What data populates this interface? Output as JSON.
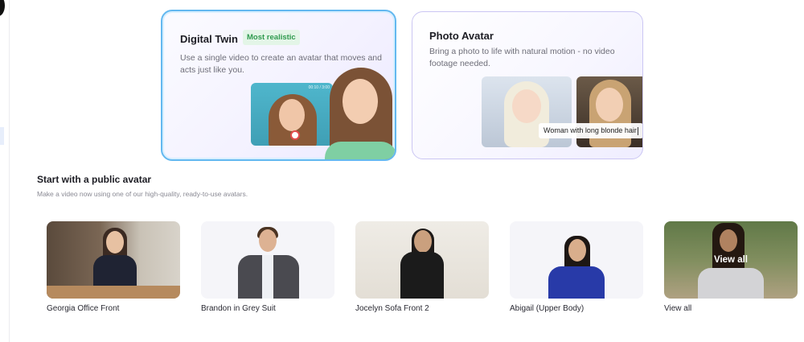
{
  "cards": {
    "digital_twin": {
      "title": "Digital Twin",
      "badge": "Most realistic",
      "description": "Use a single video to create an avatar that moves and acts just like you.",
      "video_timer": "00:10 / 3:00"
    },
    "photo_avatar": {
      "title": "Photo Avatar",
      "description": "Bring a photo to life with natural motion - no video footage needed.",
      "prompt_caption": "Woman with long blonde hair"
    }
  },
  "public_avatars": {
    "title": "Start with a public avatar",
    "subtitle": "Make a video now using one of our high-quality, ready-to-use avatars.",
    "items": [
      {
        "label": "Georgia Office Front"
      },
      {
        "label": "Brandon in Grey Suit"
      },
      {
        "label": "Jocelyn Sofa Front 2"
      },
      {
        "label": "Abigail (Upper Body)"
      },
      {
        "label": "View all",
        "overlay": "View all"
      }
    ]
  },
  "colors": {
    "twin_border": "#63b8f0",
    "badge_bg": "#e3f5e7",
    "badge_text": "#2f9a4e",
    "photo_border": "#cbc6f3"
  }
}
